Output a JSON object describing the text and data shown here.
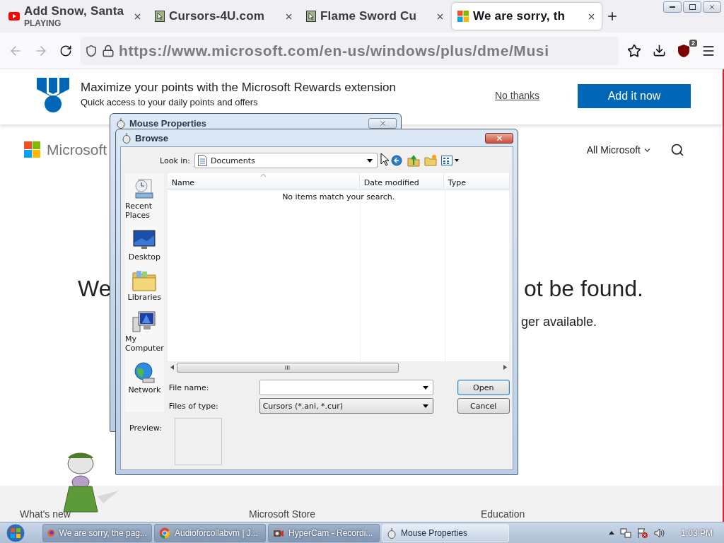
{
  "browser": {
    "tabs": [
      {
        "title": "Add Snow, Santa",
        "subtitle": "PLAYING",
        "kind": "video",
        "selected": false
      },
      {
        "title": "Cursors-4U.com",
        "kind": "cursor",
        "selected": false
      },
      {
        "title": "Flame Sword Cu",
        "kind": "cursor",
        "selected": false
      },
      {
        "title": "We are sorry, th",
        "kind": "windows",
        "selected": true
      }
    ],
    "url": "https://www.**microsoft.com**/en-us/windows/plus/dme/Musi",
    "extension_badge": "2"
  },
  "page": {
    "banner": {
      "title": "Maximize your points with the Microsoft Rewards extension",
      "subtitle": "Quick access to your daily points and offers",
      "dismiss": "No thanks",
      "action": "Add it now"
    },
    "header": {
      "brand": "Microsoft",
      "menu": "All Microsoft"
    },
    "heading_fragments": [
      "We",
      "ot be found."
    ],
    "message_fragment": "ger available.",
    "footer": [
      "What's new",
      "Microsoft Store",
      "Education"
    ]
  },
  "mouse_properties": {
    "title": "Mouse Properties"
  },
  "browse": {
    "title": "Browse",
    "look_in_label": "Look in:",
    "look_in": "Documents",
    "places": [
      {
        "label": "Recent Places",
        "kind": "recent"
      },
      {
        "label": "Desktop",
        "kind": "desktop"
      },
      {
        "label": "Libraries",
        "kind": "libraries"
      },
      {
        "label": "My Computer",
        "kind": "computer"
      },
      {
        "label": "Network",
        "kind": "network"
      }
    ],
    "columns": [
      "Name",
      "Date modified",
      "Type"
    ],
    "empty_message": "No items match your search.",
    "file_name_label": "File name:",
    "file_type_label": "Files of type:",
    "file_type": "Cursors (*.ani, *.cur)",
    "buttons": [
      {
        "label": "Open",
        "default": true
      },
      {
        "label": "Cancel",
        "default": false
      }
    ],
    "preview_label": "Preview:"
  },
  "taskbar": {
    "tasks": [
      {
        "label": "We are sorry, the pag...",
        "kind": "firefox",
        "active": false
      },
      {
        "label": "Audioforcollabvm | J...",
        "kind": "chrome",
        "active": false
      },
      {
        "label": "HyperCam - Recordi...",
        "kind": "camera",
        "active": false
      },
      {
        "label": "Mouse Properties",
        "kind": "mouse",
        "active": true
      }
    ],
    "clock": "1:03 PM"
  }
}
